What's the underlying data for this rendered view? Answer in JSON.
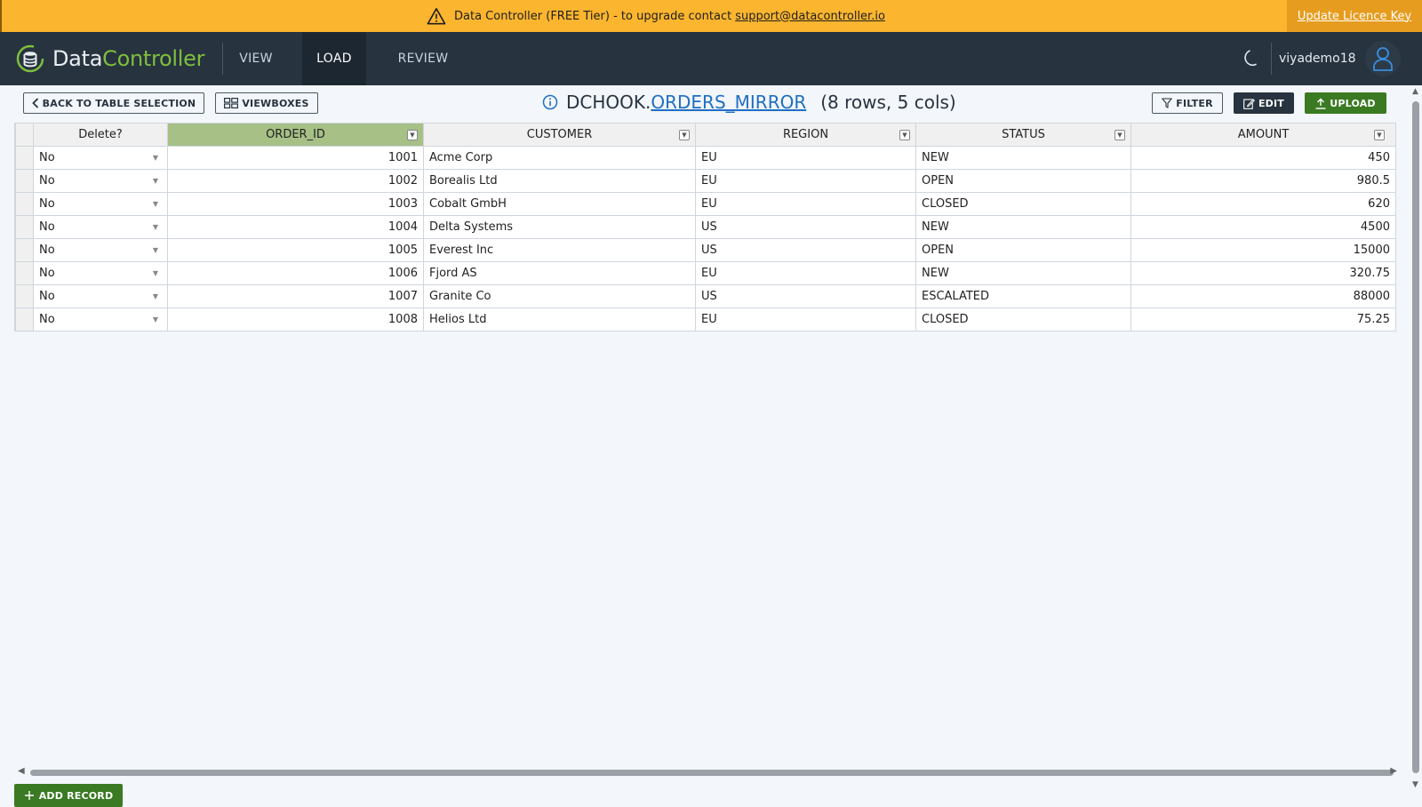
{
  "banner": {
    "message": "Data Controller (FREE Tier) - to upgrade contact",
    "email": "support@datacontroller.io",
    "licence_link": "Update Licence Key"
  },
  "header": {
    "logo_part1": "Data",
    "logo_part2": "Controller",
    "nav": [
      "VIEW",
      "LOAD",
      "REVIEW"
    ],
    "active_nav": "LOAD",
    "username": "viyademo18"
  },
  "toolbar": {
    "back_label": "BACK TO TABLE SELECTION",
    "viewboxes_label": "VIEWBOXES",
    "filter_label": "FILTER",
    "edit_label": "EDIT",
    "upload_label": "UPLOAD"
  },
  "title": {
    "library": "DCHOOK.",
    "table": "ORDERS_MIRROR",
    "meta": "(8 rows, 5 cols)"
  },
  "grid": {
    "columns": [
      "Delete?",
      "ORDER_ID",
      "CUSTOMER",
      "REGION",
      "STATUS",
      "AMOUNT"
    ],
    "rows": [
      [
        "No",
        "1001",
        "Acme Corp",
        "EU",
        "NEW",
        "450"
      ],
      [
        "No",
        "1002",
        "Borealis Ltd",
        "EU",
        "OPEN",
        "980.5"
      ],
      [
        "No",
        "1003",
        "Cobalt GmbH",
        "EU",
        "CLOSED",
        "620"
      ],
      [
        "No",
        "1004",
        "Delta Systems",
        "US",
        "NEW",
        "4500"
      ],
      [
        "No",
        "1005",
        "Everest Inc",
        "US",
        "OPEN",
        "15000"
      ],
      [
        "No",
        "1006",
        "Fjord AS",
        "EU",
        "NEW",
        "320.75"
      ],
      [
        "No",
        "1007",
        "Granite Co",
        "US",
        "ESCALATED",
        "88000"
      ],
      [
        "No",
        "1008",
        "Helios Ltd",
        "EU",
        "CLOSED",
        "75.25"
      ]
    ]
  },
  "footer": {
    "add_record_label": "ADD RECORD"
  },
  "colors": {
    "banner": "#fbb52f",
    "header": "#27333f",
    "accent_green": "#3a7a23",
    "selected_column": "#a6c086",
    "link": "#1f6fc2"
  }
}
